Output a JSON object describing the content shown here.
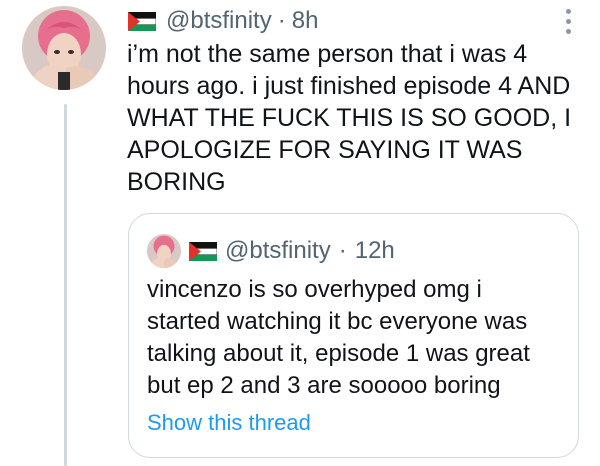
{
  "tweet": {
    "avatar_icon": "profile-avatar-pink-hair",
    "flag_icon": "palestine-flag-icon",
    "handle": "@btsfinity",
    "separator": "·",
    "time": "8h",
    "text_lines": [
      "i’m not the same person that i was 4",
      "hours ago. i just finished episode 4 AND",
      "WHAT THE FUCK THIS IS SO GOOD, I",
      "APOLOGIZE FOR SAYING IT WAS",
      "BORING"
    ]
  },
  "quoted_tweet": {
    "handle": "@btsfinity",
    "separator": "·",
    "time": "12h",
    "text_lines": [
      "vincenzo is so overhyped omg i",
      "started watching it bc everyone was",
      "talking about it, episode 1 was great",
      "but ep 2 and 3 are sooooo boring"
    ],
    "show_thread_label": "Show this thread"
  },
  "colors": {
    "link": "#1d9bf0",
    "muted": "#536471",
    "border": "#cfd9de",
    "flag_red": "#e4312b",
    "flag_green": "#149954"
  }
}
